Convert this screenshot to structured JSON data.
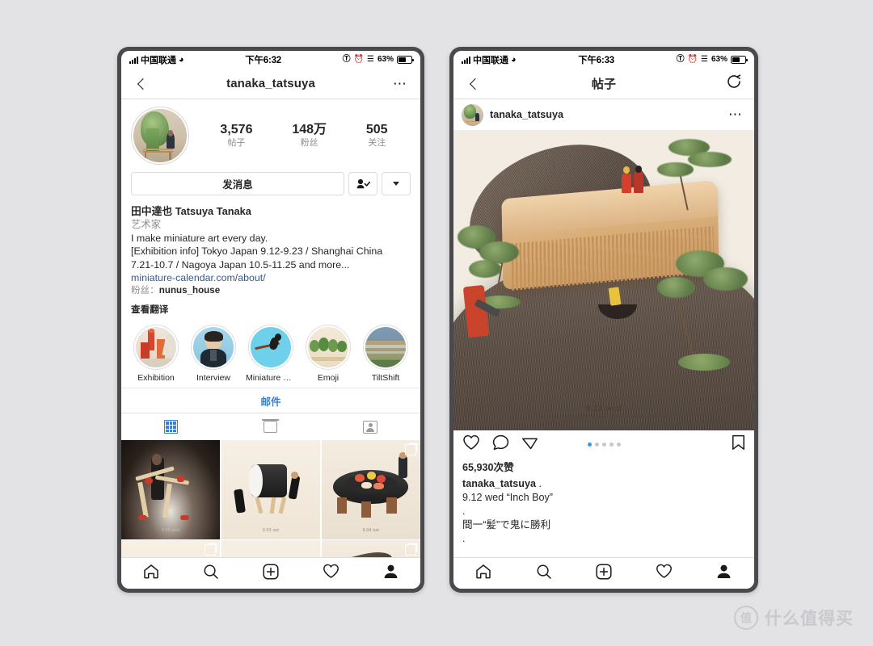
{
  "watermark": {
    "logo_char": "值",
    "text": "什么值得买"
  },
  "left_phone": {
    "status": {
      "carrier": "中国联通",
      "time": "下午6:32",
      "battery_percent": "63%",
      "icons": [
        "signal-bars",
        "wifi-icon",
        "rotation-lock-icon",
        "alarm-icon",
        "bluetooth-icon",
        "battery-icon"
      ]
    },
    "navbar": {
      "back": "back-chevron",
      "title": "tanaka_tatsuya",
      "more": "⋯"
    },
    "profile": {
      "stats": [
        {
          "num": "3,576",
          "label": "帖子"
        },
        {
          "num": "148万",
          "label": "粉丝"
        },
        {
          "num": "505",
          "label": "关注"
        }
      ],
      "message_button": "发消息",
      "following_button": "person-check-icon",
      "dropdown_button": "chevron-down-icon",
      "name": "田中達也 Tatsuya Tanaka",
      "category": "艺术家",
      "bio_line1": "I make miniature art every day.",
      "bio_line2": "[Exhibition info] Tokyo Japan 9.12-9.23 / Shanghai China",
      "bio_line3": "7.21-10.7 / Nagoya Japan 10.5-11.25 and more...",
      "link": "miniature-calendar.com/about/",
      "followers_label": "粉丝：",
      "followers_value": "nunus_house",
      "translate": "查看翻译",
      "highlights": [
        {
          "label": "Exhibition"
        },
        {
          "label": "Interview"
        },
        {
          "label": "Miniature GO"
        },
        {
          "label": "Emoji"
        },
        {
          "label": "TiltShift"
        }
      ],
      "mail_button": "邮件",
      "tabs": [
        {
          "name": "grid-tab",
          "active": true
        },
        {
          "name": "tv-tab",
          "active": false
        },
        {
          "name": "tagged-tab",
          "active": false
        }
      ]
    },
    "tabbar": [
      "home-icon",
      "search-icon",
      "add-post-icon",
      "activity-heart-icon",
      "profile-icon"
    ]
  },
  "right_phone": {
    "status": {
      "carrier": "中国联通",
      "time": "下午6:33",
      "battery_percent": "63%",
      "icons": [
        "signal-bars",
        "wifi-icon",
        "rotation-lock-icon",
        "alarm-icon",
        "bluetooth-icon",
        "battery-icon"
      ]
    },
    "navbar": {
      "back": "back-chevron",
      "title": "帖子",
      "refresh": "refresh-icon"
    },
    "post": {
      "username": "tanaka_tatsuya",
      "more": "⋯",
      "image_caption_date": "9.12",
      "image_caption_day": "wed",
      "image_caption_sub": "MINIATURE CALENDAR   www.miniature-calendar.com",
      "carousel_dots": 5,
      "carousel_active_index": 0,
      "likes": "65,930次赞",
      "caption_user": "tanaka_tatsuya",
      "caption_line1": ".",
      "caption_line2": "9.12 wed “Inch Boy”",
      "caption_line3": ".",
      "caption_line4": "間一“髪”で鬼に勝利",
      "caption_line5": ".",
      "actions": [
        "like-heart-icon",
        "comment-icon",
        "share-icon",
        "bookmark-icon"
      ]
    },
    "tabbar": [
      "home-icon",
      "search-icon",
      "add-post-icon",
      "activity-heart-icon",
      "profile-icon"
    ]
  }
}
